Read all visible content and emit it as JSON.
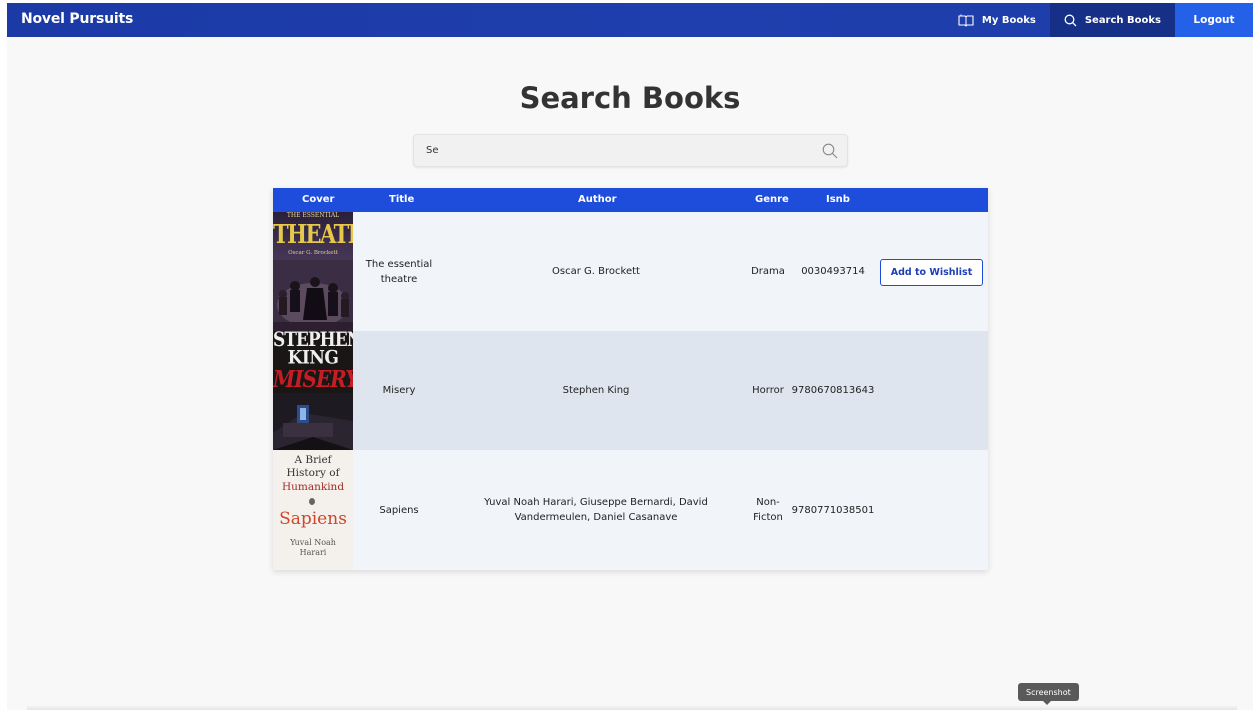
{
  "app": {
    "brand": "Novel Pursuits"
  },
  "nav": {
    "my_books": "My Books",
    "search_books": "Search Books",
    "logout": "Logout"
  },
  "page": {
    "title": "Search Books"
  },
  "search": {
    "value": "Se",
    "icon": "search-icon"
  },
  "table": {
    "headers": {
      "cover": "Cover",
      "title": "Title",
      "author": "Author",
      "genre": "Genre",
      "isbn": "Isnb"
    },
    "rows": [
      {
        "title": "The essential theatre",
        "author": "Oscar G. Brockett",
        "genre": "Drama",
        "isbn": "0030493714",
        "action": "Add to Wishlist",
        "cover": {
          "line1": "THE ESSENTIAL",
          "line2": "THEATRE",
          "line3": "Oscar G. Brockett"
        }
      },
      {
        "title": "Misery",
        "author": "Stephen King",
        "genre": "Horror",
        "isbn": "9780670813643",
        "cover": {
          "line1": "STEPHEN",
          "line2": "KING",
          "line3": "MISERY"
        }
      },
      {
        "title": "Sapiens",
        "author": "Yuval Noah Harari, Giuseppe Bernardi, David Vandermeulen, Daniel Casanave",
        "genre": "Non-Ficton",
        "isbn": "9780771038501",
        "cover": {
          "line1": "A Brief",
          "line2": "History of",
          "line3": "Humankind",
          "line4": "Sapiens",
          "line5": "Yuval Noah",
          "line6": "Harari"
        }
      }
    ]
  },
  "tooltip": {
    "text": "Screenshot"
  },
  "colors": {
    "navbar": "#1f3fae",
    "table_header": "#1e4ddb",
    "logout": "#2561e8"
  }
}
